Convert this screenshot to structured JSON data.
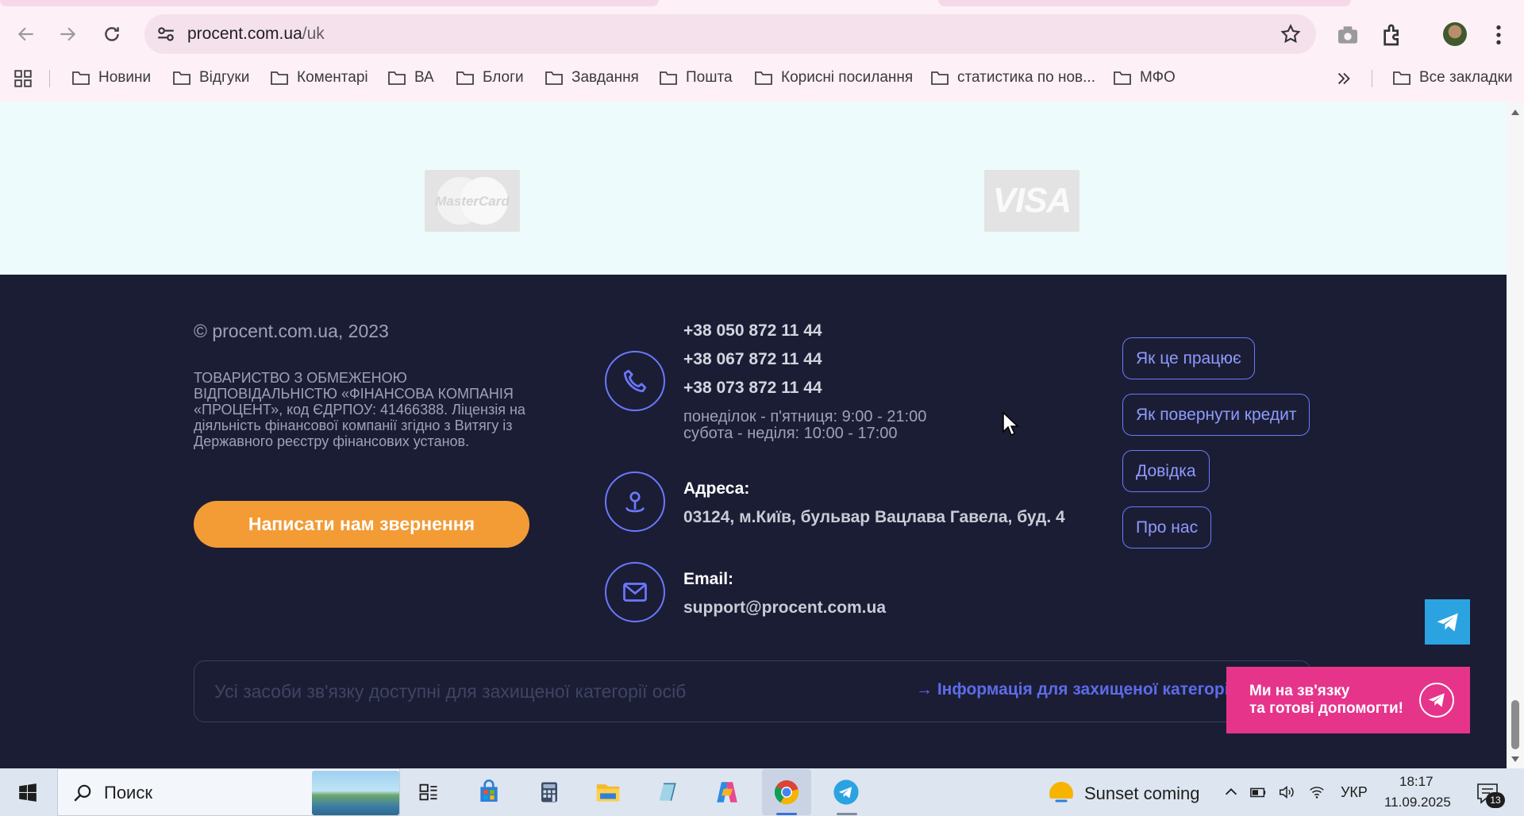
{
  "browser": {
    "url_host": "procent.com.ua",
    "url_path": "/uk",
    "bookmarks": [
      "Новини",
      "Відгуки",
      "Коментарі",
      "ВА",
      "Блоги",
      "Завдання",
      "Пошта",
      "Корисні посилання",
      "статистика по нов...",
      "МФО"
    ],
    "all_bookmarks": "Все закладки"
  },
  "payments": {
    "mastercard": "MasterCard",
    "visa": "VISA"
  },
  "footer": {
    "copyright": "© procent.com.ua, 2023",
    "legal": "ТОВАРИСТВО З ОБМЕЖЕНОЮ ВІДПОВІДАЛЬНІСТЮ «ФІНАНСОВА КОМПАНІЯ «ПРОЦЕНТ», код ЄДРПОУ: 41466388. Ліцензія на діяльність фінансової компанії згідно з Витягу із Державного реєстру фінансових установ.",
    "cta_button": "Написати нам звернення",
    "phones": [
      "+38 050 872 11 44",
      "+38 067 872 11 44",
      "+38 073 872 11 44"
    ],
    "hours_weekdays": "понеділок - п'ятниця: 9:00 - 21:00",
    "hours_weekend": "субота - неділя: 10:00 - 17:00",
    "address_label": "Адреса:",
    "address_value": "03124, м.Київ, бульвар Вацлава Гавела, буд. 4",
    "email_label": "Email:",
    "email_value": "support@procent.com.ua",
    "nav": [
      "Як це працює",
      "Як повернути кредит",
      "Довідка",
      "Про нас"
    ],
    "notice_text": "Усі засоби зв'язку доступні для захищеної категорії осіб",
    "notice_link": "→ Інформація для захищеної категорії осіб"
  },
  "help_widget": {
    "line1": "Ми на зв'язку",
    "line2": "та готові допомогти!"
  },
  "taskbar": {
    "search_placeholder": "Поиск",
    "weather": "Sunset coming",
    "language": "УКР",
    "time": "18:17",
    "date": "11.09.2025",
    "notifications": "13"
  },
  "colors": {
    "footer_bg": "#1b1d34",
    "accent_blue": "#6b78ff",
    "cta_orange": "#f39b35",
    "widget_pink": "#e6348b",
    "telegram_blue": "#2ba3e1"
  }
}
